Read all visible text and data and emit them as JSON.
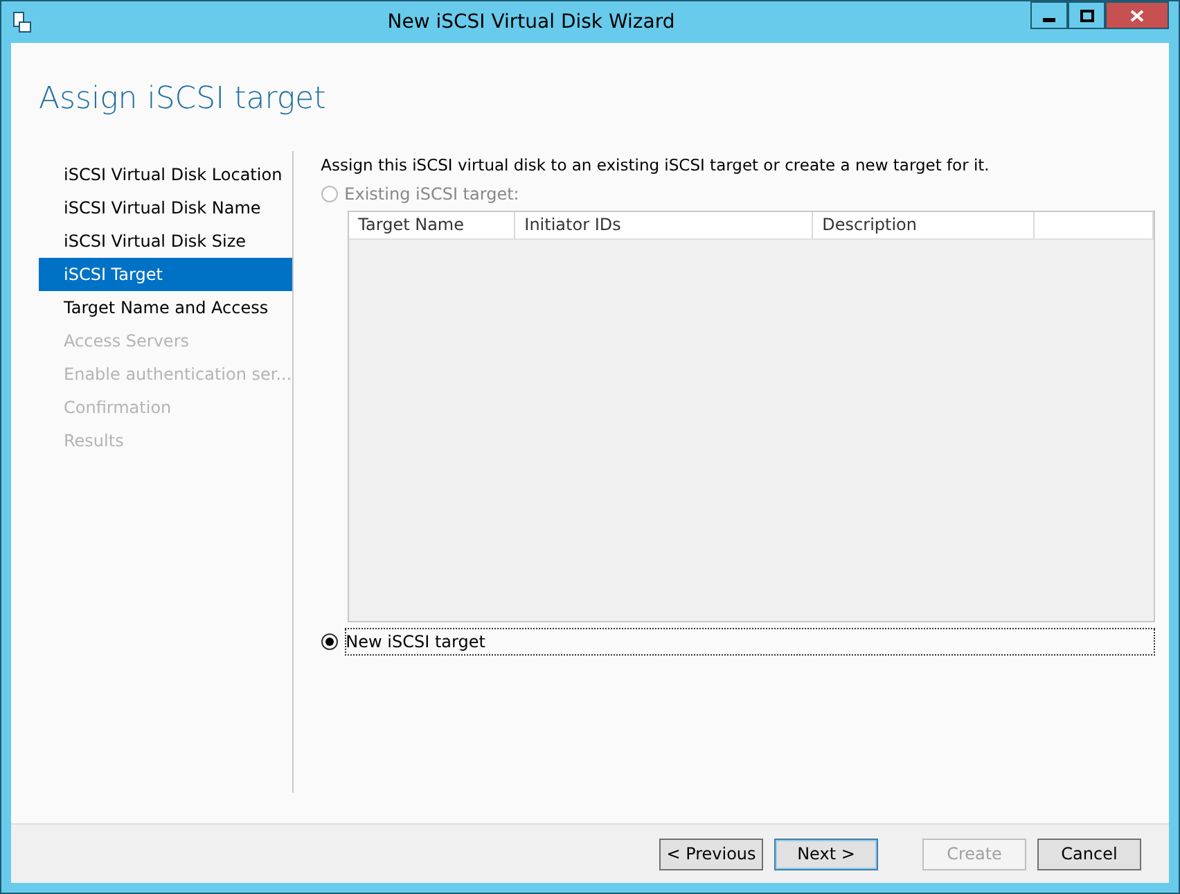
{
  "window": {
    "title": "New iSCSI Virtual Disk Wizard"
  },
  "page_title": "Assign iSCSI target",
  "steps": [
    {
      "label": "iSCSI Virtual Disk Location",
      "selected": false,
      "disabled": false
    },
    {
      "label": "iSCSI Virtual Disk Name",
      "selected": false,
      "disabled": false
    },
    {
      "label": "iSCSI Virtual Disk Size",
      "selected": false,
      "disabled": false
    },
    {
      "label": "iSCSI Target",
      "selected": true,
      "disabled": false
    },
    {
      "label": "Target Name and Access",
      "selected": false,
      "disabled": false
    },
    {
      "label": "Access Servers",
      "selected": false,
      "disabled": true
    },
    {
      "label": "Enable authentication ser...",
      "selected": false,
      "disabled": true
    },
    {
      "label": "Confirmation",
      "selected": false,
      "disabled": true
    },
    {
      "label": "Results",
      "selected": false,
      "disabled": true
    }
  ],
  "instruction": "Assign this iSCSI virtual disk to an existing iSCSI target or create a new target for it.",
  "options": [
    {
      "label": "Existing iSCSI target:",
      "selected": false,
      "disabled": true
    },
    {
      "label": "New iSCSI target",
      "selected": true,
      "disabled": false
    }
  ],
  "table": {
    "columns": [
      "Target Name",
      "Initiator IDs",
      "Description"
    ]
  },
  "buttons": [
    {
      "label": "< Previous",
      "disabled": false,
      "default": false
    },
    {
      "label": "Next >",
      "disabled": false,
      "default": true
    },
    {
      "label": "Create",
      "disabled": true,
      "default": false
    },
    {
      "label": "Cancel",
      "disabled": false,
      "default": false
    }
  ]
}
